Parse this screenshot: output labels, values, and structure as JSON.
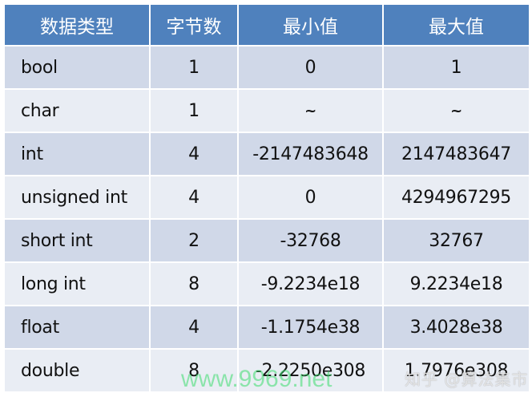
{
  "table": {
    "headers": [
      "数据类型",
      "字节数",
      "最小值",
      "最大值"
    ],
    "rows": [
      {
        "type": "bool",
        "bytes": "1",
        "min": "0",
        "max": "1"
      },
      {
        "type": "char",
        "bytes": "1",
        "min": "~",
        "max": "~"
      },
      {
        "type": "int",
        "bytes": "4",
        "min": "-2147483648",
        "max": "2147483647"
      },
      {
        "type": "unsigned int",
        "bytes": "4",
        "min": "0",
        "max": "4294967295"
      },
      {
        "type": "short int",
        "bytes": "2",
        "min": "-32768",
        "max": "32767"
      },
      {
        "type": "long int",
        "bytes": "8",
        "min": "-9.2234e18",
        "max": "9.2234e18"
      },
      {
        "type": "float",
        "bytes": "4",
        "min": "-1.1754e38",
        "max": "3.4028e38"
      },
      {
        "type": "double",
        "bytes": "8",
        "min": "-2.2250e308",
        "max": "1.7976e308"
      }
    ]
  },
  "colors": {
    "header_bg": "#4f81bd",
    "row_dark": "#d0d8e8",
    "row_light": "#e9edf4"
  },
  "watermarks": {
    "site": "www.9969.net",
    "zhihu": "知乎 @算法集市"
  }
}
